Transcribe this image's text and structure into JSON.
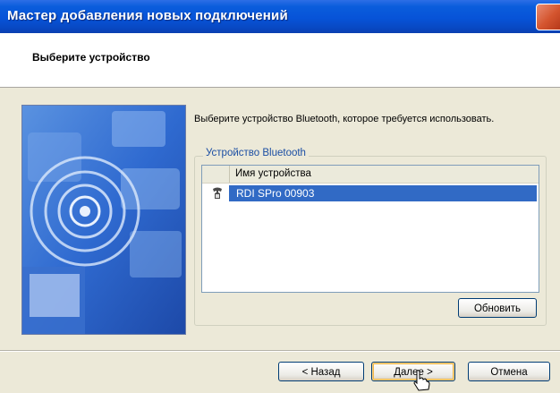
{
  "window": {
    "title": "Мастер добавления новых подключений"
  },
  "header": {
    "title": "Выберите устройство"
  },
  "content": {
    "instruction": "Выберите устройство Bluetooth, которое требуется использовать.",
    "group_label": "Устройство Bluetooth",
    "list": {
      "column_header": "Имя устройства",
      "items": [
        {
          "name": "RDI SPro 00903",
          "icon": "phone-icon",
          "selected": true
        }
      ]
    },
    "refresh_label": "Обновить"
  },
  "footer": {
    "back_label": "< Назад",
    "next_label": "Далее >",
    "cancel_label": "Отмена"
  },
  "colors": {
    "titlebar": "#0753d8",
    "selection": "#316ac5",
    "dialog_bg": "#ECE9D8",
    "group_label": "#1b4ea3"
  }
}
